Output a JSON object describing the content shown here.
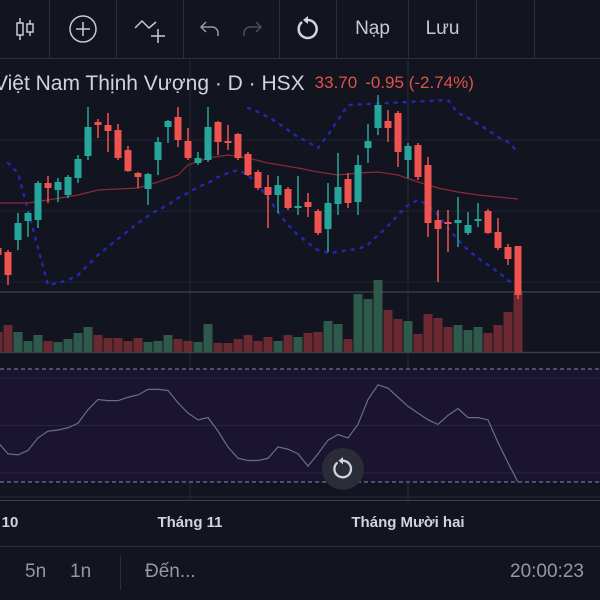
{
  "toolbar": {
    "load_label": "Nạp",
    "save_label": "Lưu",
    "icons": [
      "candles-icon",
      "add-circle-icon",
      "indicators-icon",
      "undo-icon",
      "redo-icon",
      "reset-icon"
    ]
  },
  "legend": {
    "symbol_title": "Việt Nam Thịnh Vượng · D · HSX",
    "last_price": "33.70",
    "change": "-0.95 (-2.74%)"
  },
  "time_axis": {
    "labels": [
      "10",
      "Tháng 11",
      "Tháng Mười hai"
    ]
  },
  "bottom_bar": {
    "range_5d": "5n",
    "range_1d": "1n",
    "goto_label": "Đến...",
    "clock": "20:00:23"
  },
  "colors": {
    "up": "#26a69a",
    "down": "#ef5350",
    "accent": "#e0524a",
    "band": "#2a2ad0",
    "ma": "#8b2a36",
    "osc_line": "#6b6f7b"
  },
  "chart_data": {
    "type": "candlestick",
    "ylim": [
      33.7,
      43.7
    ],
    "candles": [
      [
        36.05,
        35.7,
        36.15,
        35.55
      ],
      [
        35.85,
        34.7,
        35.95,
        34.2
      ],
      [
        36.45,
        37.3,
        37.8,
        35.95
      ],
      [
        37.4,
        37.8,
        37.85,
        36.6
      ],
      [
        37.45,
        39.3,
        39.4,
        37.05
      ],
      [
        39.3,
        39.05,
        39.65,
        38.3
      ],
      [
        38.95,
        39.35,
        39.55,
        38.35
      ],
      [
        38.7,
        39.6,
        39.7,
        38.55
      ],
      [
        39.55,
        40.5,
        40.7,
        39.3
      ],
      [
        40.65,
        42.1,
        43.1,
        40.45
      ],
      [
        42.35,
        42.2,
        42.5,
        41.55
      ],
      [
        42.2,
        41.9,
        42.8,
        40.85
      ],
      [
        41.95,
        40.55,
        42.25,
        40.45
      ],
      [
        40.95,
        39.9,
        41.15,
        39.85
      ],
      [
        39.8,
        39.6,
        39.85,
        39.05
      ],
      [
        39.0,
        39.75,
        39.8,
        38.2
      ],
      [
        40.45,
        41.35,
        41.6,
        39.7
      ],
      [
        42.1,
        42.4,
        42.45,
        41.3
      ],
      [
        42.6,
        41.45,
        43.1,
        41.1
      ],
      [
        41.4,
        40.55,
        42.05,
        40.45
      ],
      [
        40.3,
        40.55,
        40.85,
        40.2
      ],
      [
        40.45,
        42.1,
        43.1,
        40.35
      ],
      [
        42.35,
        41.35,
        42.4,
        40.7
      ],
      [
        41.4,
        41.3,
        42.2,
        40.95
      ],
      [
        41.75,
        40.55,
        41.8,
        40.45
      ],
      [
        40.75,
        39.7,
        40.85,
        39.65
      ],
      [
        39.85,
        39.05,
        39.95,
        38.95
      ],
      [
        39.1,
        38.7,
        39.7,
        37.05
      ],
      [
        38.7,
        39.2,
        39.65,
        37.8
      ],
      [
        39.0,
        38.05,
        39.1,
        37.95
      ],
      [
        38.05,
        38.15,
        39.65,
        37.7
      ],
      [
        38.35,
        38.1,
        38.8,
        37.6
      ],
      [
        37.9,
        36.8,
        38.0,
        36.7
      ],
      [
        37.0,
        38.3,
        39.3,
        35.85
      ],
      [
        38.25,
        39.1,
        40.8,
        37.7
      ],
      [
        39.5,
        38.3,
        39.8,
        38.05
      ],
      [
        38.35,
        40.2,
        40.7,
        37.7
      ],
      [
        41.05,
        41.4,
        42.25,
        40.3
      ],
      [
        42.05,
        43.2,
        43.7,
        41.7
      ],
      [
        42.4,
        42.05,
        42.95,
        41.35
      ],
      [
        42.8,
        40.85,
        42.9,
        40.1
      ],
      [
        40.45,
        41.15,
        41.3,
        39.55
      ],
      [
        41.2,
        39.6,
        41.3,
        39.45
      ],
      [
        40.2,
        37.3,
        40.6,
        36.6
      ],
      [
        37.45,
        37.0,
        37.95,
        34.35
      ],
      [
        37.35,
        37.25,
        37.95,
        35.85
      ],
      [
        37.3,
        37.45,
        38.6,
        36.1
      ],
      [
        36.8,
        37.2,
        37.85,
        36.7
      ],
      [
        37.4,
        37.5,
        38.3,
        37.1
      ],
      [
        37.9,
        36.8,
        38.0,
        36.75
      ],
      [
        36.85,
        36.05,
        37.55,
        35.95
      ],
      [
        36.1,
        35.5,
        36.25,
        35.2
      ],
      [
        36.15,
        33.7,
        36.15,
        33.5
      ]
    ],
    "volume": [
      20,
      27,
      20,
      11,
      17,
      11,
      10,
      13,
      19,
      25,
      17,
      14,
      14,
      11,
      14,
      10,
      11,
      17,
      13,
      11,
      10,
      28,
      9,
      9,
      13,
      17,
      11,
      15,
      11,
      17,
      15,
      19,
      20,
      31,
      28,
      13,
      58,
      53,
      72,
      42,
      33,
      31,
      18,
      38,
      34,
      25,
      27,
      22,
      25,
      19,
      27,
      40,
      59
    ],
    "upper_band": [
      [
        25,
        43.05
      ],
      [
        26,
        42.85
      ],
      [
        27,
        42.6
      ],
      [
        28,
        42.3
      ],
      [
        29,
        41.95
      ],
      [
        30,
        41.6
      ],
      [
        31,
        41.35
      ],
      [
        32,
        41.05
      ],
      [
        33,
        41.7
      ],
      [
        34,
        42.45
      ],
      [
        35,
        43.2
      ],
      [
        45,
        43.45
      ],
      [
        46,
        42.8
      ],
      [
        47,
        42.55
      ],
      [
        48,
        42.25
      ],
      [
        49,
        41.95
      ],
      [
        50,
        41.6
      ],
      [
        51,
        41.35
      ],
      [
        52,
        40.85
      ]
    ],
    "lower_band": [
      [
        1,
        40.3
      ],
      [
        2,
        39.8
      ],
      [
        5,
        34.2
      ],
      [
        6,
        34.3
      ],
      [
        7,
        34.45
      ],
      [
        8,
        34.7
      ],
      [
        9,
        35.2
      ],
      [
        10,
        35.7
      ],
      [
        11,
        36.1
      ],
      [
        12,
        36.5
      ],
      [
        13,
        36.9
      ],
      [
        14,
        37.3
      ],
      [
        15,
        37.65
      ],
      [
        16,
        37.95
      ],
      [
        17,
        38.2
      ],
      [
        18,
        38.55
      ],
      [
        19,
        38.8
      ],
      [
        20,
        39.1
      ],
      [
        21,
        39.3
      ],
      [
        22,
        39.6
      ],
      [
        23,
        39.8
      ],
      [
        24,
        39.95
      ],
      [
        25,
        39.7
      ],
      [
        26,
        39.2
      ],
      [
        27,
        38.55
      ],
      [
        28,
        37.85
      ],
      [
        29,
        37.2
      ],
      [
        30,
        36.7
      ],
      [
        31,
        36.3
      ],
      [
        32,
        35.95
      ],
      [
        33,
        35.8
      ],
      [
        34,
        35.85
      ],
      [
        35,
        35.95
      ],
      [
        36,
        36.0
      ],
      [
        37,
        36.2
      ],
      [
        38,
        36.7
      ],
      [
        39,
        37.15
      ],
      [
        40,
        37.7
      ],
      [
        41,
        38.2
      ],
      [
        42,
        38.45
      ],
      [
        43,
        38.2
      ],
      [
        44,
        37.7
      ],
      [
        45,
        37.05
      ],
      [
        46,
        36.45
      ],
      [
        47,
        35.95
      ],
      [
        48,
        35.55
      ],
      [
        49,
        35.2
      ],
      [
        50,
        34.85
      ],
      [
        51,
        34.45
      ],
      [
        52,
        34.05
      ]
    ],
    "moving_average": [
      [
        0,
        38.3
      ],
      [
        3,
        38.3
      ],
      [
        5,
        38.45
      ],
      [
        8,
        38.7
      ],
      [
        10,
        38.95
      ],
      [
        14,
        39.05
      ],
      [
        16,
        39.35
      ],
      [
        18,
        39.7
      ],
      [
        19,
        40.2
      ],
      [
        21,
        40.55
      ],
      [
        23,
        40.7
      ],
      [
        25,
        40.55
      ],
      [
        27,
        40.3
      ],
      [
        30,
        40.05
      ],
      [
        32,
        39.85
      ],
      [
        34,
        39.7
      ],
      [
        36,
        39.8
      ],
      [
        38,
        39.85
      ],
      [
        40,
        39.7
      ],
      [
        42,
        39.35
      ],
      [
        44,
        39.05
      ],
      [
        46,
        38.85
      ],
      [
        48,
        38.7
      ],
      [
        52,
        38.5
      ]
    ],
    "oscillator": {
      "range": [
        0,
        100
      ],
      "values": [
        35,
        25,
        24,
        28,
        39,
        45,
        46,
        48,
        52,
        64,
        73,
        72,
        72,
        75,
        77,
        82,
        82,
        81,
        70,
        61,
        55,
        57,
        45,
        31,
        21,
        19,
        19,
        21,
        31,
        29,
        25,
        14,
        25,
        37,
        42,
        39,
        51,
        73,
        86,
        83,
        75,
        67,
        61,
        55,
        51,
        59,
        65,
        57,
        57,
        55,
        35,
        17,
        0
      ]
    }
  }
}
